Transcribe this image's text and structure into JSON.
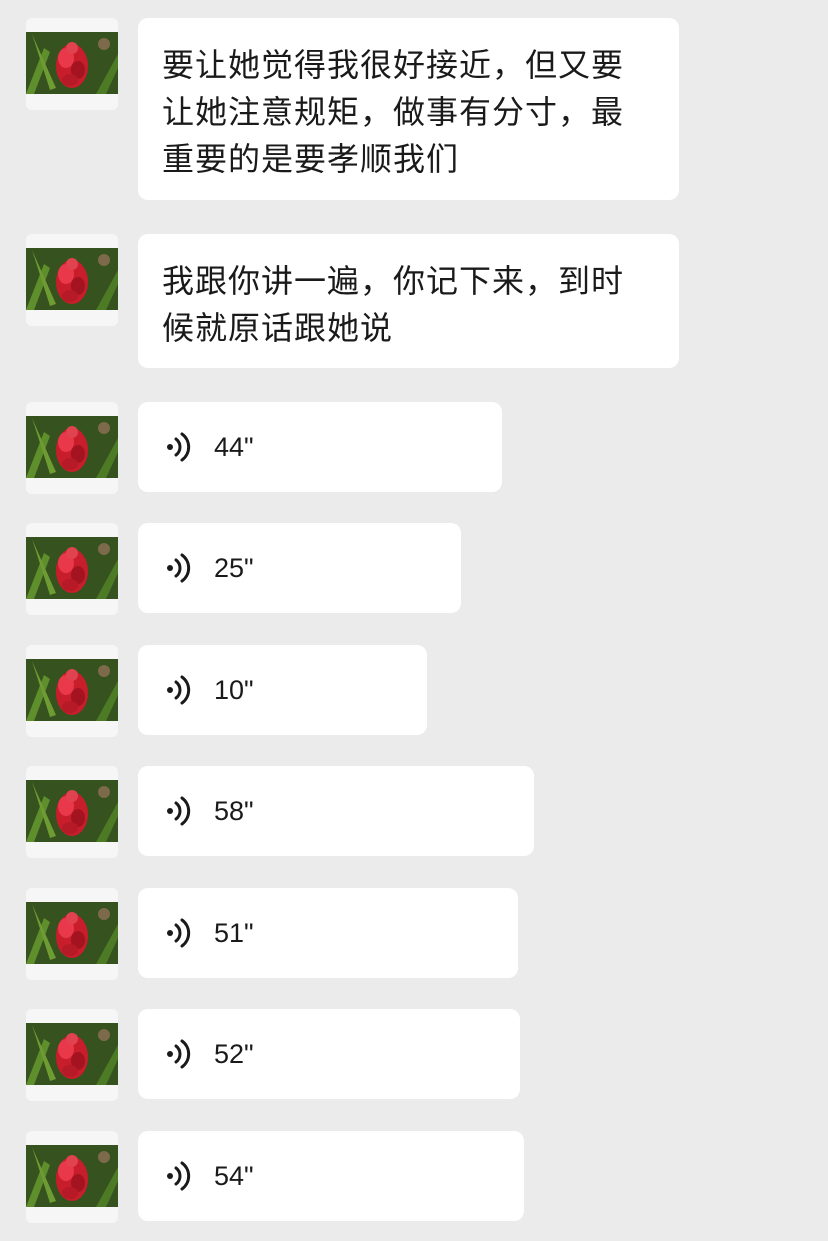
{
  "messages": [
    {
      "type": "text",
      "text": "要让她觉得我很好接近，但又要让她注意规矩，做事有分寸，最重要的是要孝顺我们"
    },
    {
      "type": "text",
      "text": "我跟你讲一遍，你记下来，到时候就原话跟她说"
    },
    {
      "type": "voice",
      "duration": "44\""
    },
    {
      "type": "voice",
      "duration": "25\""
    },
    {
      "type": "voice",
      "duration": "10\""
    },
    {
      "type": "voice",
      "duration": "58\""
    },
    {
      "type": "voice",
      "duration": "51\""
    },
    {
      "type": "voice",
      "duration": "52\""
    },
    {
      "type": "voice",
      "duration": "54\""
    }
  ],
  "colors": {
    "background": "#ebebeb",
    "bubble": "#ffffff",
    "text": "#1a1a1a",
    "avatar_flower": "#d8232f",
    "avatar_leaves": "#2f5a1d"
  },
  "icons": {
    "avatar": "red-flower-photo",
    "voice": "voice-wave-icon"
  }
}
